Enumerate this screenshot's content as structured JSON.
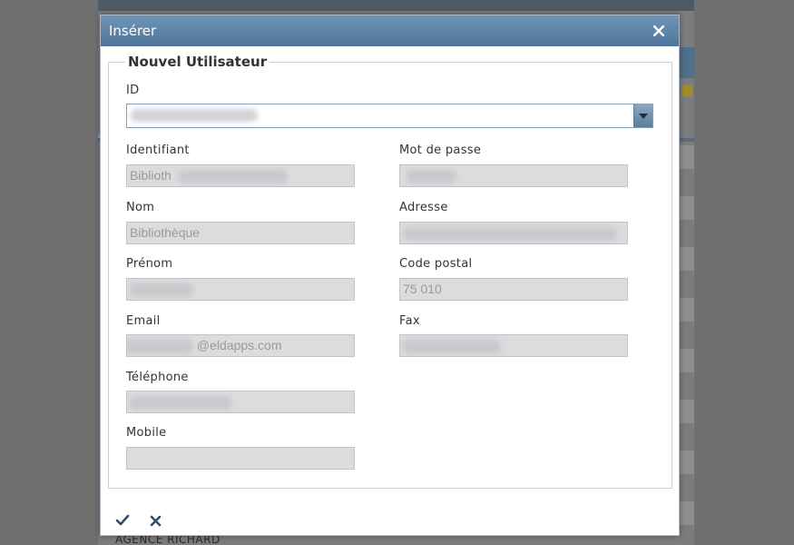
{
  "background": {
    "footer_text": "AGENCE RICHARD"
  },
  "dialog": {
    "title": "Insérer",
    "close_icon": "close-icon",
    "legend": "Nouvel Utilisateur",
    "fields": {
      "id": {
        "label": "ID",
        "value": ""
      },
      "identifiant": {
        "label": "Identifiant",
        "value": "Biblioth"
      },
      "mot_de_passe": {
        "label": "Mot de passe",
        "value": ""
      },
      "nom": {
        "label": "Nom",
        "value": "Bibliothèque"
      },
      "adresse": {
        "label": "Adresse",
        "value": ""
      },
      "prenom": {
        "label": "Prénom",
        "value": ""
      },
      "code_postal": {
        "label": "Code postal",
        "value": "75 010"
      },
      "email": {
        "label": "Email",
        "value": "@eldapps.com"
      },
      "fax": {
        "label": "Fax",
        "value": ""
      },
      "telephone": {
        "label": "Téléphone",
        "value": ""
      },
      "mobile": {
        "label": "Mobile",
        "value": ""
      }
    },
    "footer": {
      "confirm_icon": "checkmark-icon",
      "cancel_icon": "cross-icon"
    }
  },
  "colors": {
    "titlebar": "#5b82a6",
    "input_bg": "#dcdcdf",
    "icon": "#2f4f6f"
  }
}
